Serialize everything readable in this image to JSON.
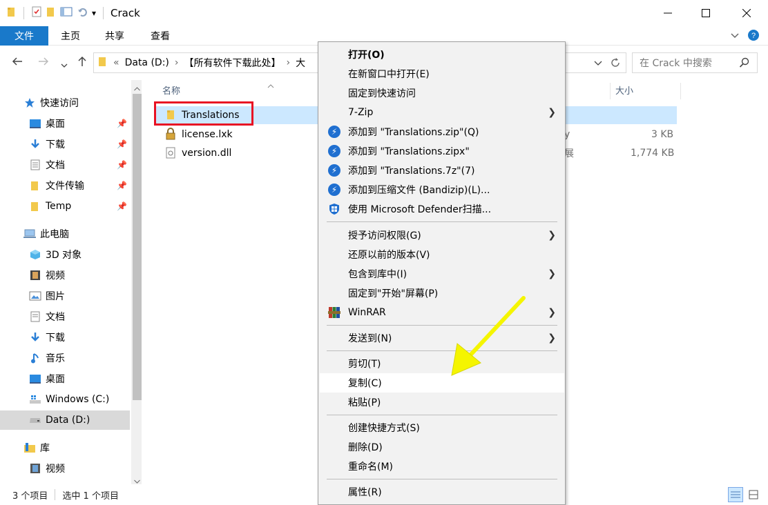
{
  "window": {
    "title": "Crack",
    "qat_dropdown": "▾"
  },
  "ribbon": {
    "file_tab": "文件",
    "tabs": [
      "主页",
      "共享",
      "查看"
    ]
  },
  "address": {
    "overflow": "«",
    "crumbs": [
      "Data (D:)",
      "【所有软件下载此处】",
      "大"
    ]
  },
  "search": {
    "placeholder": "在 Crack 中搜索"
  },
  "sidebar": {
    "quick_access": "快速访问",
    "quick_items": [
      "桌面",
      "下载",
      "文档",
      "文件传输",
      "Temp"
    ],
    "this_pc": "此电脑",
    "pc_items": [
      "3D 对象",
      "视频",
      "图片",
      "文档",
      "下载",
      "音乐",
      "桌面",
      "Windows (C:)",
      "Data (D:)"
    ],
    "library": "库",
    "library_items": [
      "视频"
    ]
  },
  "filelist": {
    "col_name": "名称",
    "col_size": "大小",
    "rows": [
      {
        "name": "Translations",
        "type": "",
        "size": ""
      },
      {
        "name": "license.lxk",
        "type": "y",
        "size": "3 KB"
      },
      {
        "name": "version.dll",
        "type": "展",
        "size": "1,774 KB"
      }
    ]
  },
  "status": {
    "count": "3 个项目",
    "selected": "选中 1 个项目"
  },
  "context_menu": {
    "items": [
      "打开(O)",
      "在新窗口中打开(E)",
      "固定到快速访问",
      "7-Zip",
      "添加到 \"Translations.zip\"(Q)",
      "添加到 \"Translations.zipx\"",
      "添加到 \"Translations.7z\"(7)",
      "添加到压缩文件 (Bandizip)(L)...",
      "使用 Microsoft Defender扫描...",
      "授予访问权限(G)",
      "还原以前的版本(V)",
      "包含到库中(I)",
      "固定到\"开始\"屏幕(P)",
      "WinRAR",
      "发送到(N)",
      "剪切(T)",
      "复制(C)",
      "粘贴(P)",
      "创建快捷方式(S)",
      "删除(D)",
      "重命名(M)",
      "属性(R)"
    ]
  },
  "colors": {
    "accent": "#1979ca",
    "selection": "#cce8ff",
    "highlight_box": "#e81123",
    "arrow": "#f5f500"
  }
}
